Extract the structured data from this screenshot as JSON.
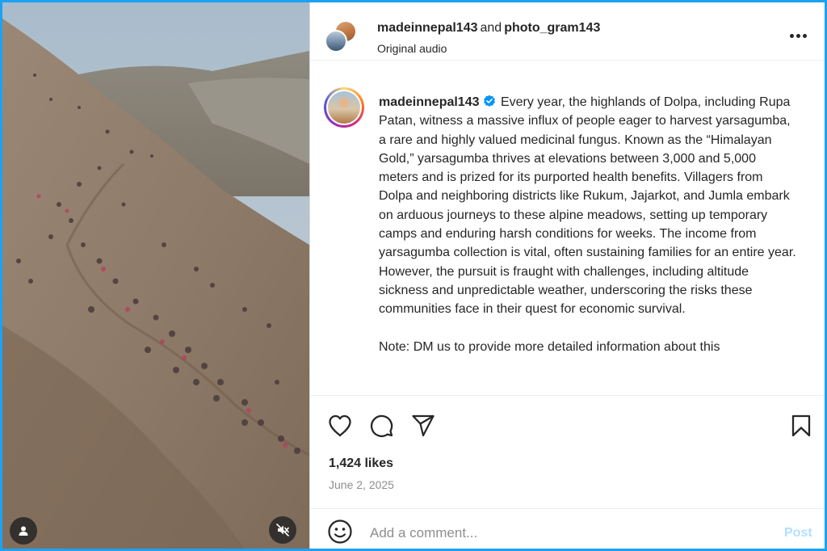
{
  "header": {
    "user1": "madeinnepal143",
    "connector": "and",
    "user2": "photo_gram143",
    "audio": "Original audio"
  },
  "caption": {
    "username": "madeinnepal143",
    "body": "Every year, the highlands of Dolpa, including Rupa Patan, witness a massive influx of people eager to harvest yarsagumba, a rare and highly valued medicinal fungus. Known as the “Himalayan Gold,” yarsagumba thrives at elevations between 3,000 and 5,000 meters and is prized for its purported health benefits. Villagers from Dolpa and neighboring districts like Rukum, Jajarkot, and Jumla embark on arduous journeys to these alpine meadows, setting up temporary camps and enduring harsh conditions for weeks. The income from yarsagumba collection is vital, often sustaining families for an entire year. However, the pursuit is fraught with challenges, including altitude sickness and unpredictable weather, underscoring the risks these communities face in their quest for economic survival.",
    "note": "Note: DM us to provide more detailed information about this"
  },
  "stats": {
    "likes": "1,424 likes",
    "date": "June 2, 2025"
  },
  "comment": {
    "placeholder": "Add a comment...",
    "post_label": "Post"
  },
  "icons": {
    "more": "more-options-icon",
    "verified": "verified-badge-icon",
    "like": "heart-icon",
    "comment": "comment-bubble-icon",
    "share": "paper-plane-icon",
    "save": "bookmark-icon",
    "emoji": "emoji-smile-icon",
    "user_tag": "user-tag-icon",
    "mute": "speaker-muted-icon"
  },
  "colors": {
    "accent": "#0095f6",
    "post_disabled": "#b2dffc",
    "frame": "#1da1f2",
    "text": "#262626",
    "muted": "#8e8e8e"
  }
}
